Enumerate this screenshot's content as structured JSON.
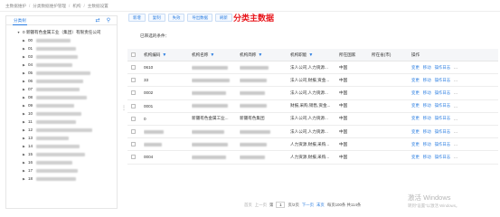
{
  "breadcrumb": [
    "主数据维护",
    "分类数据维护管理",
    "机构",
    "主数据设置"
  ],
  "left_panel": {
    "tab_label": "分类树",
    "tree_root": "0 新疆有色金属工业（集团）有限责任公司",
    "tree_nodes": [
      "00",
      "01",
      "03",
      "04",
      "05",
      "06",
      "07",
      "08",
      "09",
      "10",
      "11",
      "12",
      "13",
      "14",
      "15",
      "16",
      "17",
      "18"
    ]
  },
  "toolbar": {
    "buttons": [
      "新增",
      "复制",
      "失效",
      "导出数据",
      "刷新"
    ]
  },
  "page_title": "分类主数据",
  "filter_label": "已筛选的条件：",
  "table": {
    "headers": {
      "code": "机构编码",
      "name": "机构名称",
      "short": "机构简称",
      "type": "机构职能",
      "country": "所在国家",
      "city": "所在省(市)",
      "ops": "操作"
    },
    "rows": [
      {
        "code": "0610",
        "name": "",
        "short": "",
        "type": "法人公司,人力资源...",
        "country": "中国"
      },
      {
        "code": "33",
        "name": "",
        "short": "",
        "type": "法人公司,财报,资金...",
        "country": "中国"
      },
      {
        "code": "0002",
        "name": "",
        "short": "",
        "type": "法人公司,人力资源...",
        "country": "中国"
      },
      {
        "code": "0001",
        "name": "",
        "short": "",
        "type": "财报,采购,销售,资金...",
        "country": "中国"
      },
      {
        "code": "0",
        "name": "新疆有色金属工业...",
        "short": "新疆有色集团",
        "type": "法人公司,人力资源...",
        "country": "中国"
      },
      {
        "code": "",
        "name": "",
        "short": "",
        "type": "法人公司,人力资源...",
        "country": "中国"
      },
      {
        "code": "",
        "name": "",
        "short": "",
        "type": "人力资源,财报,采购...",
        "country": "中国"
      },
      {
        "code": "0004",
        "name": "",
        "short": "",
        "type": "人力资源,财报,采购...",
        "country": "中国"
      }
    ],
    "row_ops": [
      "变更",
      "移动",
      "操作日志",
      "..."
    ]
  },
  "pager": {
    "first": "首页",
    "prev": "上一页",
    "page_prefix": "第",
    "page_value": "1",
    "page_suffix": "页/2页",
    "next": "下一页",
    "last": "末页",
    "summary": "每页100条 共114条"
  },
  "watermark": {
    "title": "激活 Windows",
    "subtitle": "转到\"设置\"以激活 Windows。"
  },
  "colors": {
    "accent": "#2a7de1",
    "title_red": "#e8151b"
  }
}
